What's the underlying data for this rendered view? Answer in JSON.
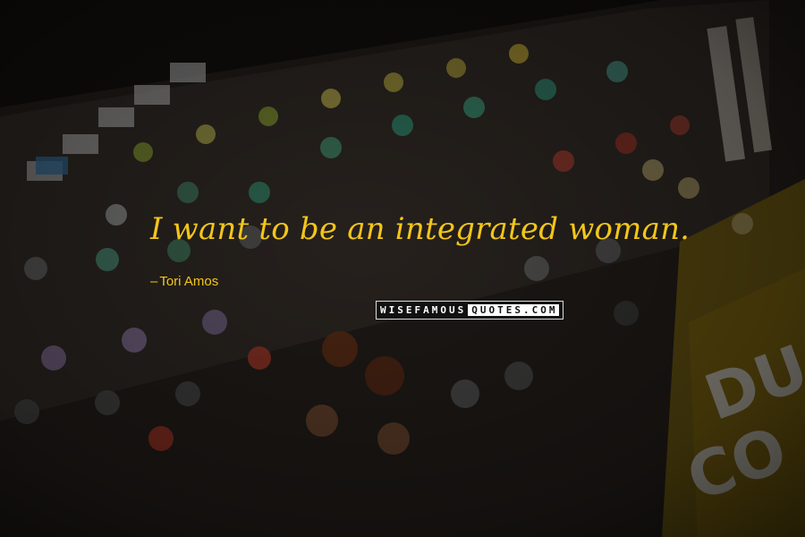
{
  "quote": {
    "text": "I want to be an integrated woman.",
    "author": "Tori Amos",
    "dash": "–"
  },
  "brand": {
    "left": "WISEFAMOUS",
    "right": "QUOTES.COM"
  },
  "colors": {
    "text": "#f2c61a",
    "panel_yellow": "#9a7a12",
    "background": "#161310"
  }
}
